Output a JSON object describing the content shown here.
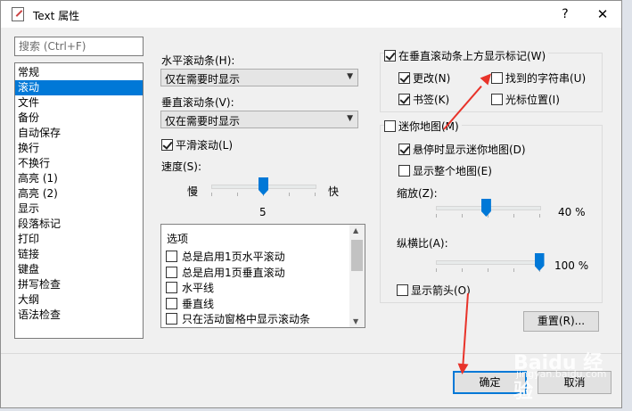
{
  "window": {
    "title": "Text 属性",
    "help_label": "?",
    "close_label": "✕"
  },
  "search": {
    "placeholder": "搜索 (Ctrl+F)"
  },
  "categories": [
    "常规",
    "滚动",
    "文件",
    "备份",
    "自动保存",
    "换行",
    "不换行",
    "高亮 (1)",
    "高亮 (2)",
    "显示",
    "段落标记",
    "打印",
    "链接",
    "键盘",
    "拼写检查",
    "大纲",
    "语法检查"
  ],
  "selected_category": "滚动",
  "horizontal_scrollbar": {
    "label": "水平滚动条(H):",
    "value": "仅在需要时显示"
  },
  "vertical_scrollbar": {
    "label": "垂直滚动条(V):",
    "value": "仅在需要时显示"
  },
  "smooth_scroll": {
    "label": "平滑滚动(L)",
    "checked": true
  },
  "speed": {
    "label": "速度(S):",
    "slow_label": "慢",
    "fast_label": "快",
    "value": "5"
  },
  "options_list": {
    "header": "选项",
    "items": [
      {
        "label": "总是启用1页水平滚动",
        "checked": false
      },
      {
        "label": "总是启用1页垂直滚动",
        "checked": false
      },
      {
        "label": "水平线",
        "checked": false
      },
      {
        "label": "垂直线",
        "checked": false
      },
      {
        "label": "只在活动窗格中显示滚动条",
        "checked": false
      }
    ]
  },
  "marks": {
    "label": "在垂直滚动条上方显示标记(W)",
    "checked": true,
    "changes": {
      "label": "更改(N)",
      "checked": true
    },
    "found_strings": {
      "label": "找到的字符串(U)",
      "checked": false
    },
    "bookmarks": {
      "label": "书签(K)",
      "checked": true
    },
    "cursor_position": {
      "label": "光标位置(I)",
      "checked": false
    }
  },
  "minimap": {
    "label": "迷你地图(M)",
    "checked": false,
    "hover_show": {
      "label": "悬停时显示迷你地图(D)",
      "checked": true
    },
    "show_whole": {
      "label": "显示整个地图(E)",
      "checked": false
    },
    "zoom": {
      "label": "缩放(Z):",
      "value": "40 %",
      "fraction": 0.4
    },
    "aspect": {
      "label": "纵横比(A):",
      "value": "100 %",
      "fraction": 1.0
    },
    "show_arrow": {
      "label": "显示箭头(O)",
      "checked": false
    }
  },
  "buttons": {
    "reset": "重置(R)...",
    "ok": "确定",
    "cancel": "取消"
  },
  "watermark": {
    "brand": "Baidu 经验",
    "url": "jingyan.baidu.com"
  },
  "colors": {
    "accent": "#0078d7",
    "arrow": "#e8332a"
  }
}
